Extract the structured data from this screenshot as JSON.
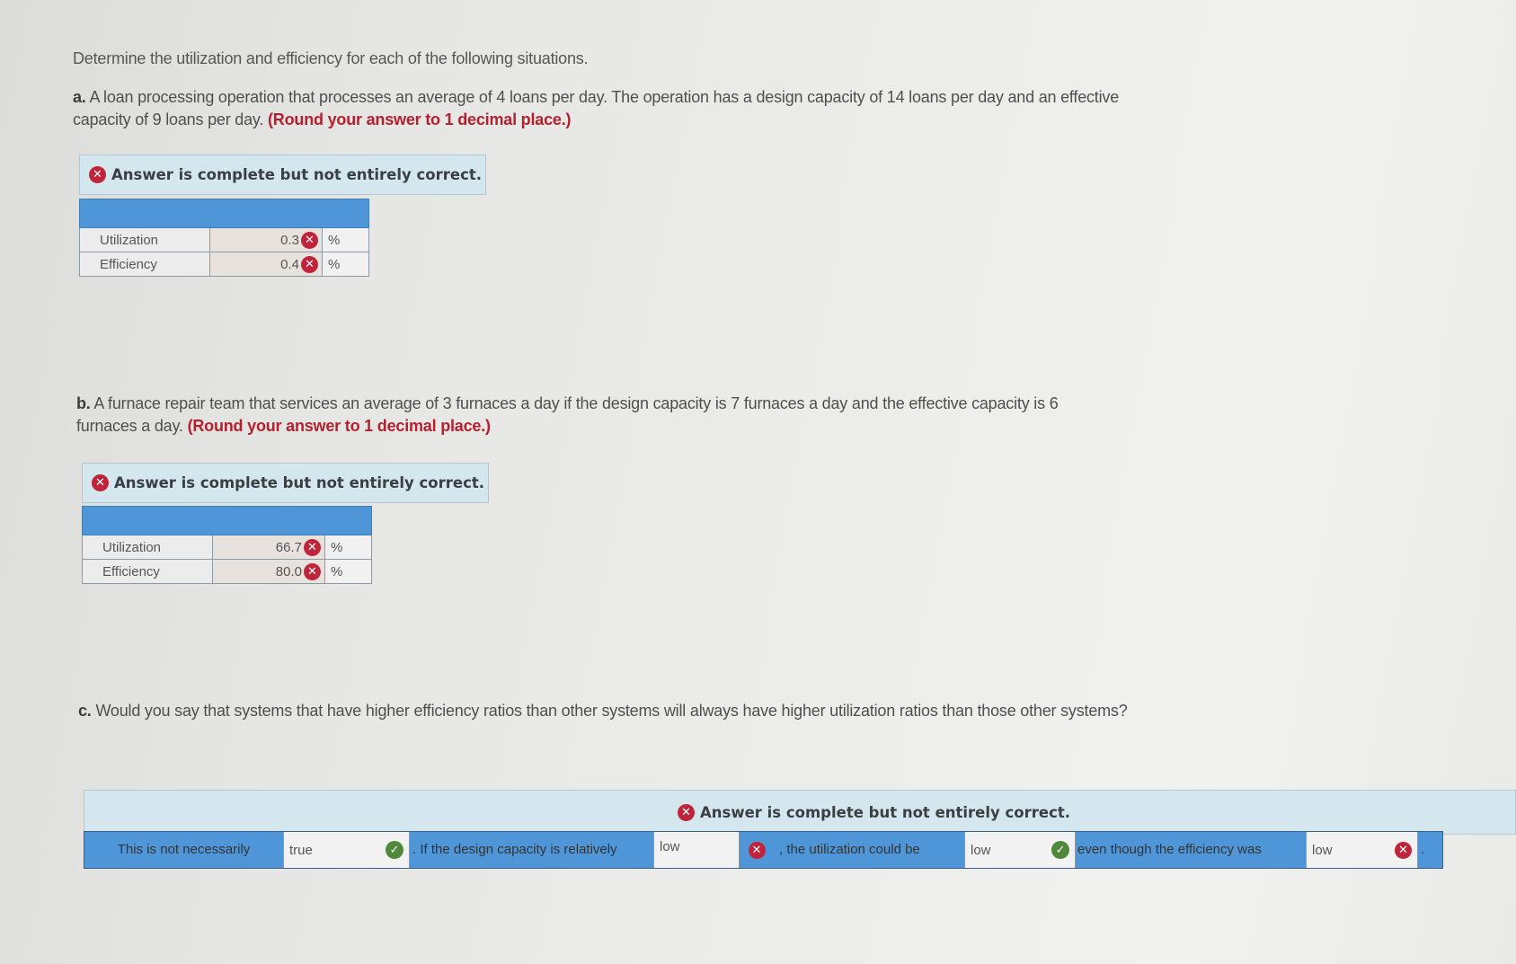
{
  "prompt": "Determine the utilization and efficiency for each of the following situations.",
  "banner_text": "Answer is complete but not entirely correct.",
  "part_a": {
    "label": "a.",
    "text": "A loan processing operation that processes an average of 4 loans per day. The operation has a design capacity of 14 loans per day and an effective capacity of 9 loans per day.",
    "instruction": "(Round your answer to 1 decimal place.)",
    "rows": [
      {
        "label": "Utilization",
        "value": "0.3",
        "unit": "%",
        "status": "incorrect"
      },
      {
        "label": "Efficiency",
        "value": "0.4",
        "unit": "%",
        "status": "incorrect"
      }
    ]
  },
  "part_b": {
    "label": "b.",
    "text": "A furnace repair team that services an average of 3 furnaces a day if the design capacity is 7 furnaces a day and the effective capacity is 6 furnaces a day.",
    "instruction": "(Round your answer to 1 decimal place.)",
    "rows": [
      {
        "label": "Utilization",
        "value": "66.7",
        "unit": "%",
        "status": "incorrect"
      },
      {
        "label": "Efficiency",
        "value": "80.0",
        "unit": "%",
        "status": "incorrect"
      }
    ]
  },
  "part_c": {
    "label": "c.",
    "text": "Would you say that systems that have higher efficiency ratios than other systems will always have higher utilization ratios than those other systems?",
    "sentence": {
      "t1": "This is not necessarily",
      "s1": {
        "value": "true",
        "status": "correct"
      },
      "t2": ". If the design capacity is relatively",
      "s2": {
        "value": "low",
        "status": "incorrect"
      },
      "t3": ", the utilization could be",
      "s3": {
        "value": "low",
        "status": "correct"
      },
      "t4": "even though the efficiency was",
      "s4": {
        "value": "low",
        "status": "incorrect"
      },
      "t5": "."
    }
  },
  "icons": {
    "incorrect": "✕",
    "correct": "✓"
  },
  "colors": {
    "incorrect": "#c0243a",
    "correct": "#4f8a3c",
    "header_blue": "#4f96d8",
    "banner_bg": "#d4e7ef",
    "instruction_red": "#b51f2e"
  }
}
